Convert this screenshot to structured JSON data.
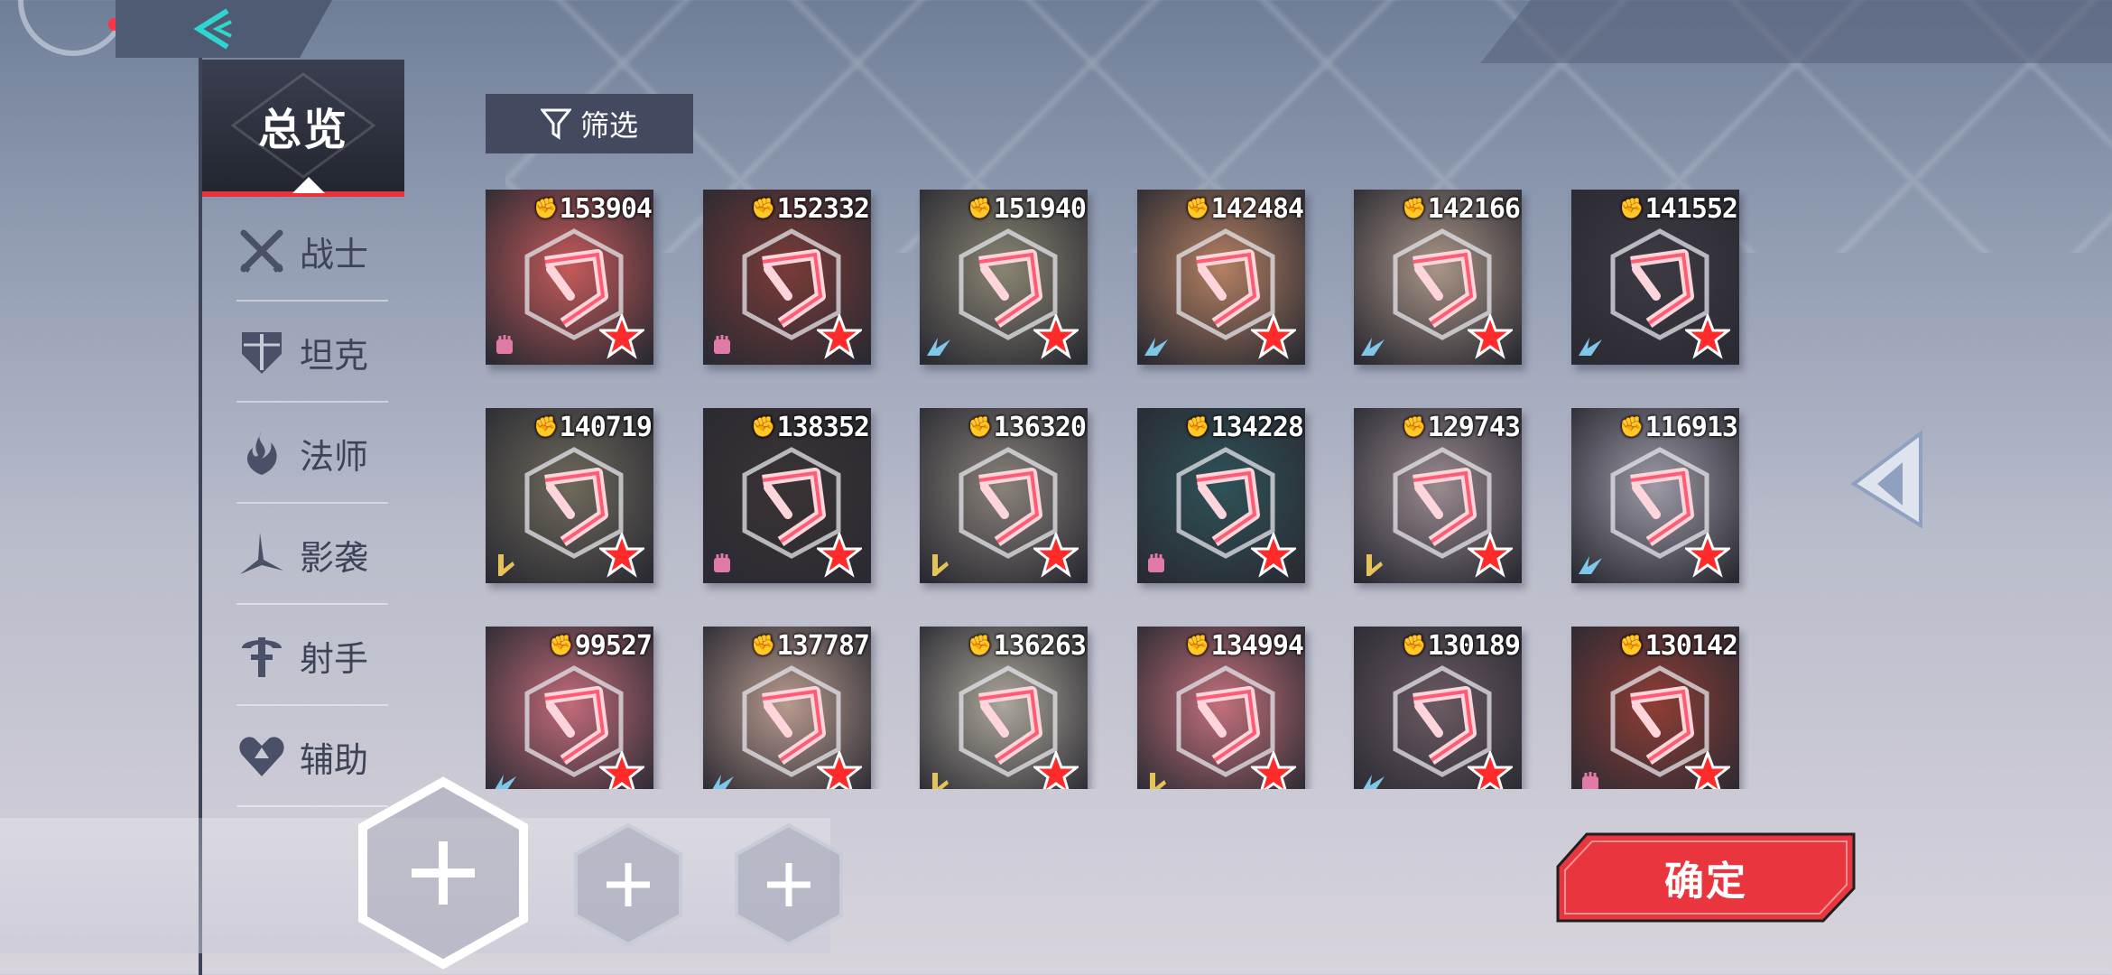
{
  "nav": {
    "back_icon": "chevron-left-icon",
    "overview_tab": "总览",
    "filter_label": "筛选",
    "confirm_label": "确定"
  },
  "categories": [
    {
      "label": "战士",
      "icon": "warrior-icon"
    },
    {
      "label": "坦克",
      "icon": "tank-icon"
    },
    {
      "label": "法师",
      "icon": "mage-icon"
    },
    {
      "label": "影袭",
      "icon": "assassin-icon"
    },
    {
      "label": "射手",
      "icon": "marksman-icon"
    },
    {
      "label": "辅助",
      "icon": "support-icon"
    }
  ],
  "characters": [
    {
      "power": "153904",
      "class_icon": "fist-icon",
      "tint": "#c45a5a"
    },
    {
      "power": "152332",
      "class_icon": "fist-icon",
      "tint": "#7a3b38"
    },
    {
      "power": "151940",
      "class_icon": "wing-icon",
      "tint": "#8a8572"
    },
    {
      "power": "142484",
      "class_icon": "wing-icon",
      "tint": "#b38062"
    },
    {
      "power": "142166",
      "class_icon": "wing-icon",
      "tint": "#a99586"
    },
    {
      "power": "141552",
      "class_icon": "wing-icon",
      "tint": "#3d3a42"
    },
    {
      "power": "140719",
      "class_icon": "pen-icon",
      "tint": "#6f6a5b"
    },
    {
      "power": "138352",
      "class_icon": "fist-icon",
      "tint": "#3a3334"
    },
    {
      "power": "136320",
      "class_icon": "pen-icon",
      "tint": "#89827a"
    },
    {
      "power": "134228",
      "class_icon": "fist-icon",
      "tint": "#2e5258"
    },
    {
      "power": "129743",
      "class_icon": "pen-icon",
      "tint": "#9a8a90"
    },
    {
      "power": "116913",
      "class_icon": "wing-icon",
      "tint": "#9d9aa6"
    },
    {
      "power": "99527",
      "class_icon": "wing-icon",
      "tint": "#c06b78"
    },
    {
      "power": "137787",
      "class_icon": "wing-icon",
      "tint": "#b79a8e"
    },
    {
      "power": "136263",
      "class_icon": "pen-icon",
      "tint": "#aca79a"
    },
    {
      "power": "134994",
      "class_icon": "pen-icon",
      "tint": "#c2707a"
    },
    {
      "power": "130189",
      "class_icon": "wing-icon",
      "tint": "#6b5a63"
    },
    {
      "power": "130142",
      "class_icon": "fist-icon",
      "tint": "#8e3d35"
    }
  ],
  "team_slots": [
    "add-slot-1",
    "add-slot-2",
    "add-slot-3"
  ],
  "colors": {
    "accent_red": "#e8333b",
    "panel_dark": "#2b2f3c",
    "text_dark": "#3e4358"
  }
}
